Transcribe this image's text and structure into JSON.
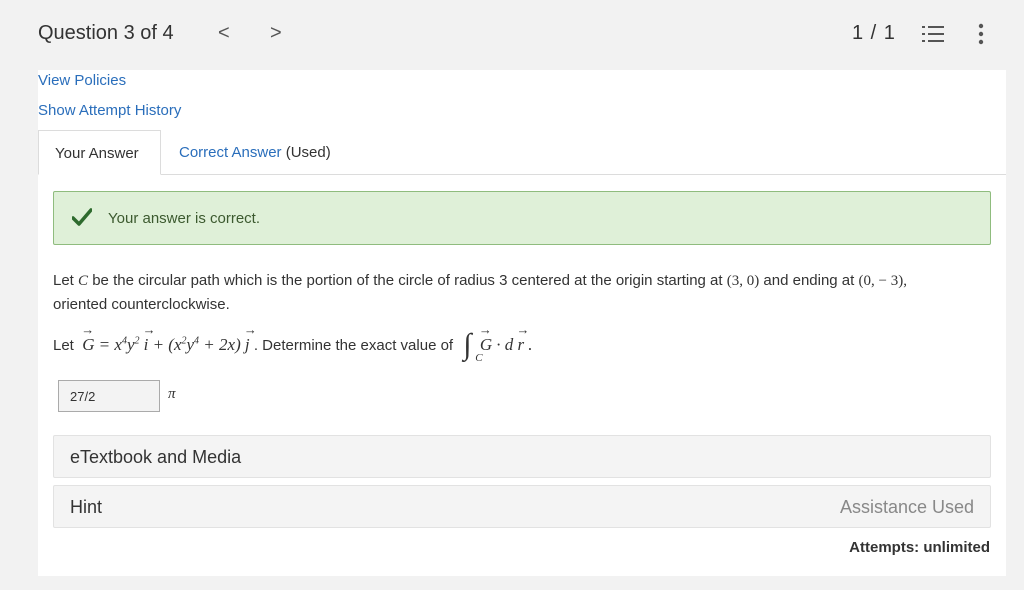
{
  "header": {
    "question_label": "Question 3 of 4",
    "prev_glyph": "<",
    "next_glyph": ">",
    "score": "1 / 1",
    "list_icon": "list-icon",
    "more_icon": "kebab-menu-icon"
  },
  "links": {
    "view_policies": "View Policies",
    "show_attempt_history": "Show Attempt History"
  },
  "tabs": {
    "your_answer": "Your Answer",
    "correct_answer": "Correct Answer",
    "correct_answer_suffix": "(Used)"
  },
  "alert": {
    "icon": "checkmark-icon",
    "text": "Your answer is correct.",
    "color": "#dff0d8"
  },
  "question": {
    "line1_prefix": "Let ",
    "line1_C": "C",
    "line1_mid": " be the circular path which is the portion of the circle of radius 3 centered at the origin starting at ",
    "start_point": "(3, 0)",
    "line1_and": " and ending at ",
    "end_point": "(0, − 3),",
    "line2": "oriented counterclockwise.",
    "formula_let": "Let",
    "G": "G",
    "equals": " = x",
    "pow4a": "4",
    "y": "y",
    "pow2a": "2",
    "i": "i",
    "plus": " + (x",
    "pow2b": "2",
    "y2": "y",
    "pow4b": "4",
    "tail": " + 2x) ",
    "j": "j",
    "determine": ". Determine the exact value of",
    "integral": "∫",
    "integral_sub": "C",
    "G2": "G",
    "dot": " · d",
    "r": "r",
    "period": "."
  },
  "answer": {
    "value": "27/2",
    "unit": "π"
  },
  "sections": {
    "etextbook": "eTextbook and Media",
    "hint": "Hint",
    "assistance": "Assistance Used"
  },
  "attempts": "Attempts: unlimited",
  "colors": {
    "link": "#2a6ebb",
    "success_bg": "#dff0d8",
    "check": "#2e6b2e"
  }
}
